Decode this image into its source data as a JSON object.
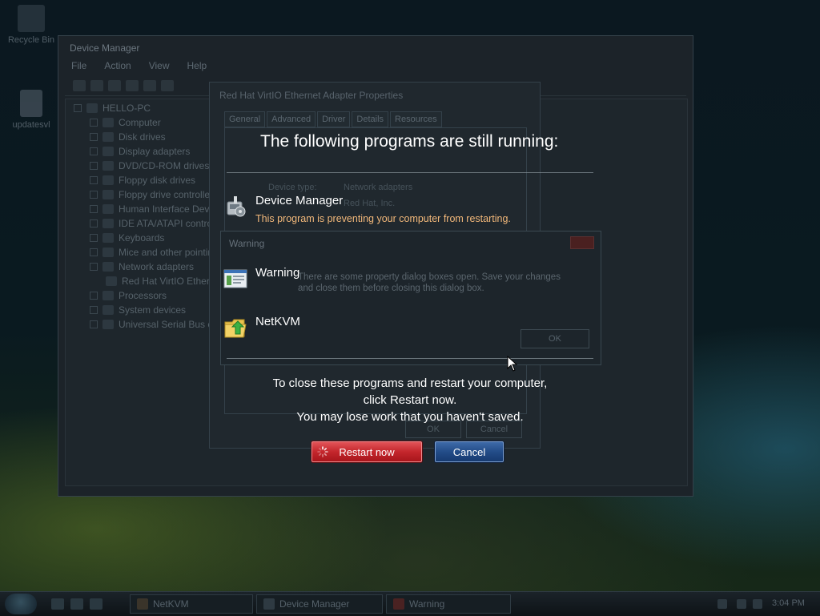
{
  "desktop": {
    "icons": [
      {
        "label": "Recycle Bin",
        "icon": "recycle-bin-icon"
      },
      {
        "label": "updatesvl",
        "icon": "file-icon"
      }
    ]
  },
  "background_windows": {
    "device_manager": {
      "title": "Device Manager",
      "menu": [
        "File",
        "Action",
        "View",
        "Help"
      ],
      "tree_root": "HELLO-PC",
      "tree_items": [
        "Computer",
        "Disk drives",
        "Display adapters",
        "DVD/CD-ROM drives",
        "Floppy disk drives",
        "Floppy drive controllers",
        "Human Interface Devices",
        "IDE ATA/ATAPI controllers",
        "Keyboards",
        "Mice and other pointing devices",
        "Network adapters",
        "Red Hat VirtIO Ethernet Adapter",
        "Processors",
        "System devices",
        "Universal Serial Bus controllers"
      ]
    },
    "properties": {
      "title": "Red Hat VirtIO Ethernet Adapter Properties",
      "tabs": [
        "General",
        "Advanced",
        "Driver",
        "Details",
        "Resources"
      ],
      "device_type_label": "Device type:",
      "device_type_value": "Network adapters",
      "manufacturer_value": "Red Hat, Inc.",
      "ok": "OK",
      "cancel": "Cancel"
    },
    "warning_dialog": {
      "title": "Warning",
      "message": "There are some property dialog boxes open. Save your changes and close them before closing this dialog box.",
      "ok": "OK"
    }
  },
  "shutdown": {
    "title": "The following programs are still running:",
    "programs": [
      {
        "name": "Device Manager",
        "note": "This program is preventing your computer from restarting.",
        "icon": "device-manager-icon"
      },
      {
        "name": "Warning",
        "note": "",
        "icon": "warning-window-icon"
      },
      {
        "name": "NetKVM",
        "note": "",
        "icon": "netkvm-folder-icon"
      }
    ],
    "message_line1": "To close these programs and restart your computer,",
    "message_line2": "click Restart now.",
    "message_line3": "You may lose work that you haven't saved.",
    "restart_label": "Restart now",
    "cancel_label": "Cancel",
    "colors": {
      "restart": "#c4262c",
      "cancel": "#234c88",
      "note": "#f2b87a"
    }
  },
  "taskbar": {
    "tasks": [
      {
        "label": "NetKVM",
        "icon": "folder-icon"
      },
      {
        "label": "Device Manager",
        "icon": "device-manager-icon"
      },
      {
        "label": "Warning",
        "icon": "warning-icon"
      }
    ],
    "clock": "3:04 PM"
  }
}
